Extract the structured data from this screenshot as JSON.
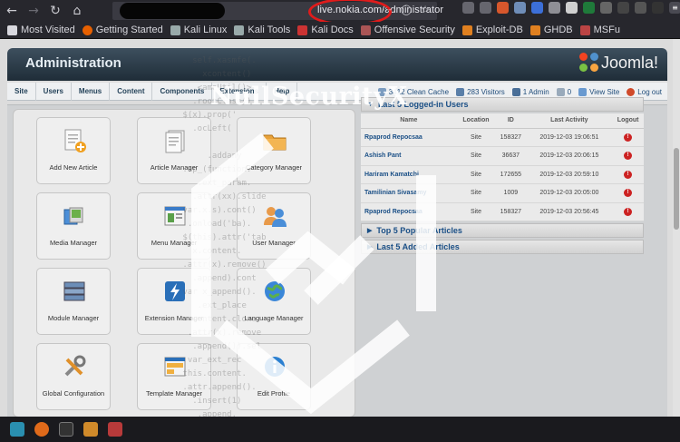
{
  "browser": {
    "url": "live.nokia.com/administrator",
    "bookmarks": [
      "Most Visited",
      "Getting Started",
      "Kali Linux",
      "Kali Tools",
      "Kali Docs",
      "Offensive Security",
      "Exploit-DB",
      "GHDB",
      "MSFu"
    ]
  },
  "header": {
    "title": "Administration",
    "logo_text": "Joomla!"
  },
  "menu": [
    "Site",
    "Users",
    "Menus",
    "Content",
    "Components",
    "Extensions",
    "Help"
  ],
  "status": {
    "clean_cache": "3412 Clean Cache",
    "visitors": "283 Visitors",
    "admins": "1 Admin",
    "messages": "0",
    "view_site": "View Site",
    "logout": "Log out"
  },
  "cpanel": [
    "Add New Article",
    "Article Manager",
    "Category Manager",
    "Media Manager",
    "Menu Manager",
    "User Manager",
    "Module Manager",
    "Extension Manager",
    "Language Manager",
    "Global Configuration",
    "Template Manager",
    "Edit Profile"
  ],
  "panels": {
    "logged_in_title": "Last 5 Logged-in Users",
    "columns": [
      "Name",
      "Location",
      "ID",
      "Last Activity",
      "Logout"
    ],
    "rows": [
      [
        "Rpaprod Repocsaa",
        "Site",
        "158327",
        "2019-12-03 19:06:51"
      ],
      [
        "Ashish Pant",
        "Site",
        "36637",
        "2019-12-03 20:06:15"
      ],
      [
        "Hariram Kamatchi",
        "Site",
        "172655",
        "2019-12-03 20:59:10"
      ],
      [
        "Tamilinian Sivasamy",
        "Site",
        "1009",
        "2019-12-03 20:05:00"
      ],
      [
        "Rpaprod Repocsaa",
        "Site",
        "158327",
        "2019-12-03 20:56:45"
      ]
    ],
    "popular_title": "Top 5 Popular Articles",
    "added_title": "Last 5 Added Articles"
  },
  "watermark": "NullSecurityX",
  "colors": {
    "accent": "#1a4f86",
    "header": "#2b3b48",
    "logout_icon": "#cc2222",
    "url_circle": "#e11b1b"
  }
}
